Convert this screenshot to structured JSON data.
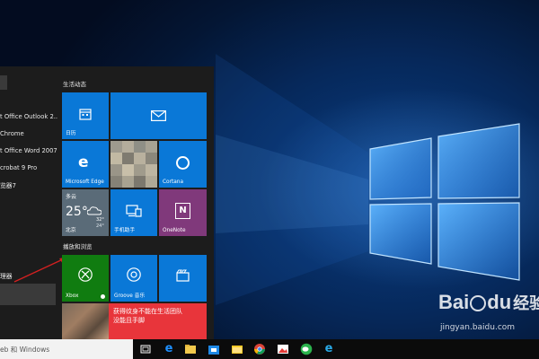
{
  "start_menu": {
    "apps": [
      {
        "label": "t Office Outlook 2..."
      },
      {
        "label": "Chrome"
      },
      {
        "label": "t Office Word 2007"
      },
      {
        "label": "crobat 9 Pro"
      },
      {
        "label": "览器7"
      },
      {
        "label": "理器"
      }
    ],
    "groups": {
      "life": "生活动态",
      "play": "播放和浏览"
    },
    "tiles": {
      "calendar": "日历",
      "mail": "",
      "edge": "Microsoft Edge",
      "cortana": "Cortana",
      "weather_condition": "多云",
      "weather_temp": "25°",
      "weather_high": "32°",
      "weather_low": "24°",
      "weather_city": "北京",
      "phone": "手机助手",
      "onenote": "OneNote",
      "xbox": "Xbox",
      "groove": "Groove 音乐",
      "movies": "",
      "news_line1": "获得纹身不能在生活团队",
      "news_line2": "没能且手脚"
    }
  },
  "taskbar": {
    "search_text": "eb 和 Windows"
  },
  "watermark": {
    "brand": "Bai",
    "brand2": "du",
    "suffix": "经验",
    "url": "jingyan.baidu.com"
  },
  "colors": {
    "tile_blue": "#0a78d7",
    "tile_purple": "#80397b",
    "tile_green": "#107c10",
    "tile_red": "#e8353b",
    "start_bg": "#1c1c1c"
  }
}
